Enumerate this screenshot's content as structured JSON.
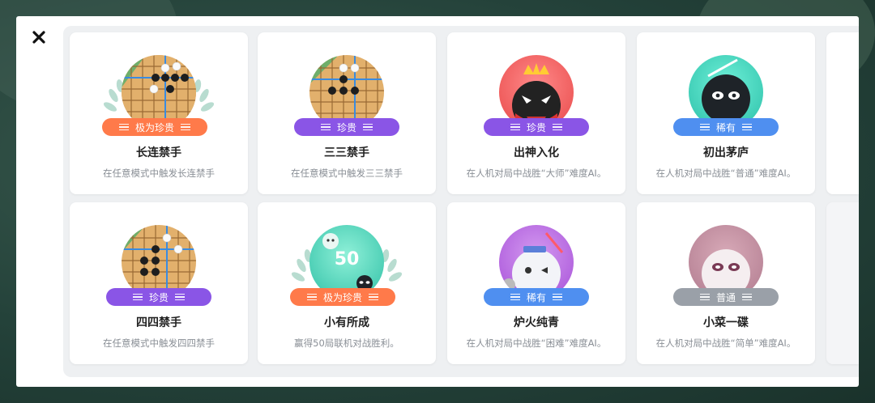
{
  "colors": {
    "legendary": "#ff7a4a",
    "rare_purple": "#8a55e6",
    "rare_blue": "#4f8ff0",
    "common": "#9aa0a8"
  },
  "icons": {
    "close": "close-icon"
  },
  "achievements": [
    {
      "title": "长连禁手",
      "rarity": "极为珍贵",
      "rarity_color": "#ff7a4a",
      "desc": "在任意模式中触发长连禁手",
      "badge": "go-board-badge"
    },
    {
      "title": "三三禁手",
      "rarity": "珍贵",
      "rarity_color": "#8a55e6",
      "desc": "在任意模式中触发三三禁手",
      "badge": "go-board-badge"
    },
    {
      "title": "出神入化",
      "rarity": "珍贵",
      "rarity_color": "#8a55e6",
      "desc": "在人机对局中战胜“大师”难度AI。",
      "badge": "crown-master-badge"
    },
    {
      "title": "初出茅庐",
      "rarity": "稀有",
      "rarity_color": "#4f8ff0",
      "desc": "在人机对局中战胜“普通”难度AI。",
      "badge": "ninja-badge"
    },
    {
      "title": "四四禁手",
      "rarity": "珍贵",
      "rarity_color": "#8a55e6",
      "desc": "在任意模式中触发四四禁手",
      "badge": "go-board-badge"
    },
    {
      "title": "小有所成",
      "rarity": "极为珍贵",
      "rarity_color": "#ff7a4a",
      "desc": "赢得50局联机对战胜利。",
      "badge": "fifty-wins-badge",
      "badge_text": "50"
    },
    {
      "title": "炉火纯青",
      "rarity": "稀有",
      "rarity_color": "#4f8ff0",
      "desc": "在人机对局中战胜“困难”难度AI。",
      "badge": "wink-robot-badge"
    },
    {
      "title": "小菜一碟",
      "rarity": "普通",
      "rarity_color": "#9aa0a8",
      "desc": "在人机对局中战胜“简单”难度AI。",
      "badge": "ghost-badge"
    }
  ]
}
